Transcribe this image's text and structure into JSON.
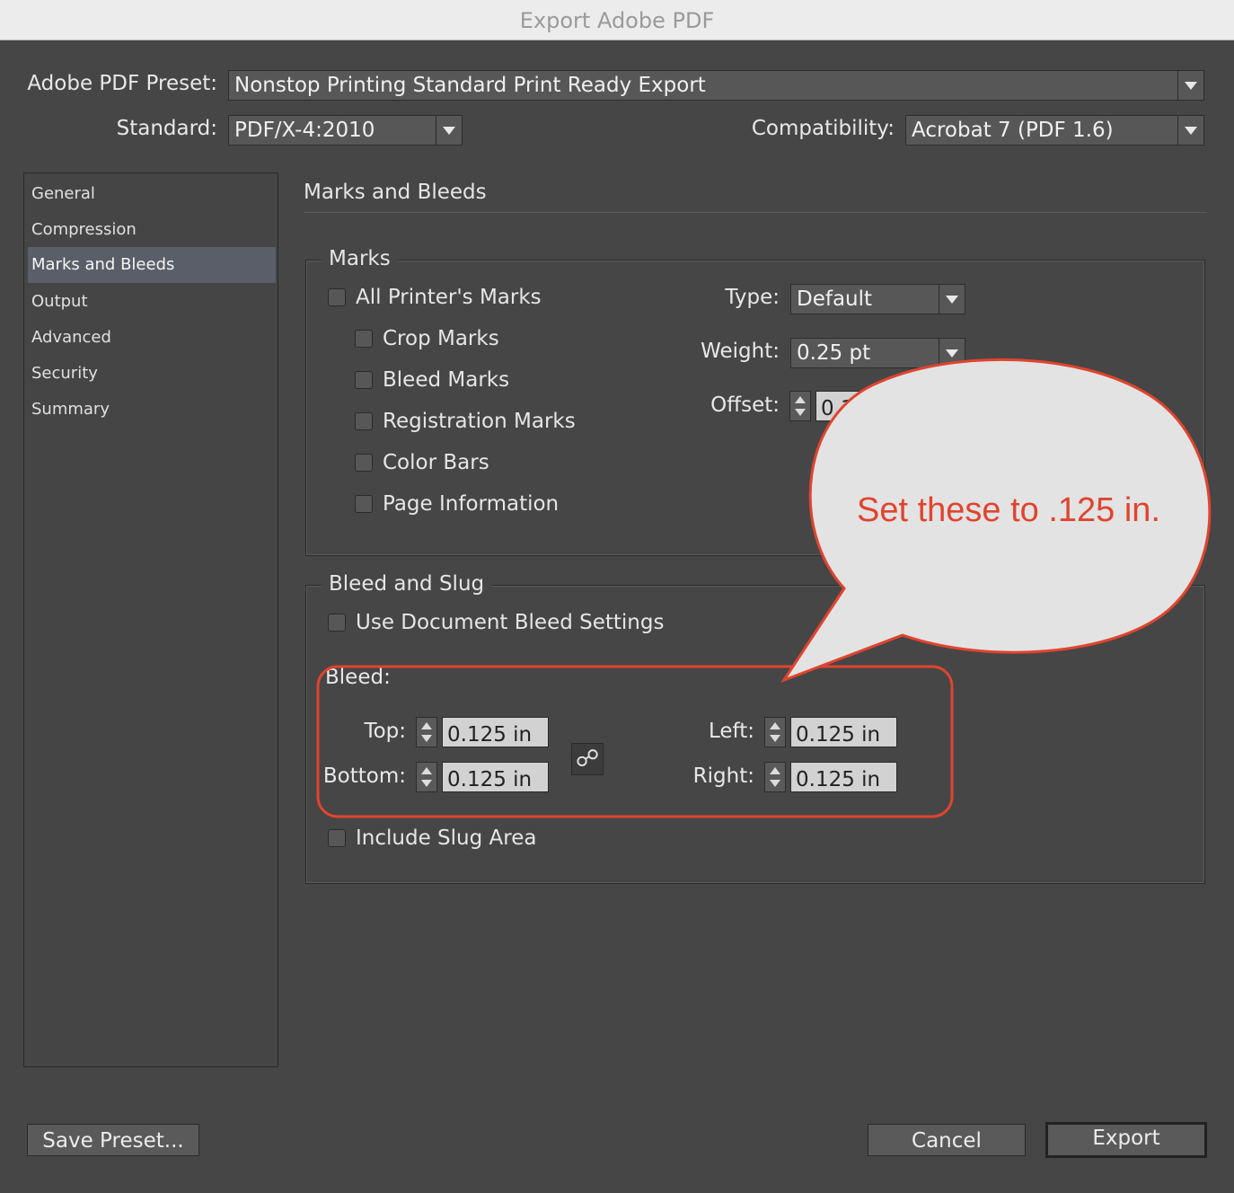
{
  "window": {
    "title": "Export Adobe PDF"
  },
  "preset": {
    "label": "Adobe PDF Preset:",
    "value": "Nonstop Printing Standard Print Ready Export"
  },
  "standard": {
    "label": "Standard:",
    "value": "PDF/X-4:2010"
  },
  "compatibility": {
    "label": "Compatibility:",
    "value": "Acrobat 7 (PDF 1.6)"
  },
  "sidebar": {
    "items": [
      {
        "label": "General"
      },
      {
        "label": "Compression"
      },
      {
        "label": "Marks and Bleeds"
      },
      {
        "label": "Output"
      },
      {
        "label": "Advanced"
      },
      {
        "label": "Security"
      },
      {
        "label": "Summary"
      }
    ],
    "selected": "Marks and Bleeds"
  },
  "panel": {
    "title": "Marks and Bleeds"
  },
  "marks": {
    "legend": "Marks",
    "all_printers_marks": "All Printer's Marks",
    "crop_marks": "Crop Marks",
    "bleed_marks": "Bleed Marks",
    "registration_marks": "Registration Marks",
    "color_bars": "Color Bars",
    "page_information": "Page Information",
    "type_label": "Type:",
    "type_value": "Default",
    "weight_label": "Weight:",
    "weight_value": "0.25 pt",
    "offset_label": "Offset:",
    "offset_value": "0.1"
  },
  "bleed_slug": {
    "legend": "Bleed and Slug",
    "use_document_bleed": "Use Document Bleed Settings",
    "bleed_label": "Bleed:",
    "top_label": "Top:",
    "top_value": "0.125 in",
    "bottom_label": "Bottom:",
    "bottom_value": "0.125 in",
    "left_label": "Left:",
    "left_value": "0.125 in",
    "right_label": "Right:",
    "right_value": "0.125 in",
    "include_slug": "Include Slug Area"
  },
  "annotation": {
    "text": "Set these to .125 in.",
    "color": "#e0442f"
  },
  "buttons": {
    "save_preset": "Save Preset...",
    "cancel": "Cancel",
    "export": "Export"
  }
}
